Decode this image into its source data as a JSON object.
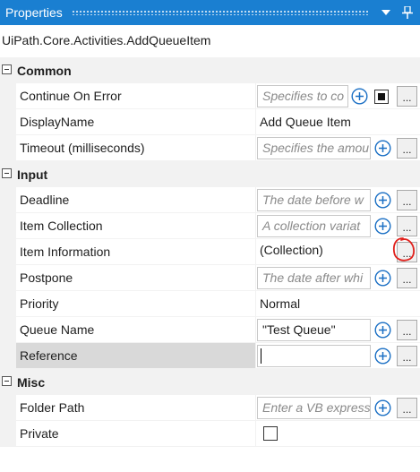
{
  "panel": {
    "title": "Properties"
  },
  "type_name": "UiPath.Core.Activities.AddQueueItem",
  "categories": [
    {
      "label": "Common",
      "properties": [
        {
          "name": "Continue On Error",
          "value": "Specifies to co",
          "placeholder": true
        },
        {
          "name": "DisplayName",
          "value": "Add Queue Item",
          "placeholder": false
        },
        {
          "name": "Timeout (milliseconds)",
          "value": "Specifies the amou",
          "placeholder": true
        }
      ]
    },
    {
      "label": "Input",
      "properties": [
        {
          "name": "Deadline",
          "value": "The date before w",
          "placeholder": true
        },
        {
          "name": "Item Collection",
          "value": "A collection variat",
          "placeholder": true
        },
        {
          "name": "Item Information",
          "value": "(Collection)",
          "placeholder": false
        },
        {
          "name": "Postpone",
          "value": "The date after whi",
          "placeholder": true
        },
        {
          "name": "Priority",
          "value": "Normal",
          "placeholder": false
        },
        {
          "name": "Queue Name",
          "value": "\"Test Queue\"",
          "placeholder": false
        },
        {
          "name": "Reference",
          "value": "",
          "placeholder": false
        }
      ]
    },
    {
      "label": "Misc",
      "properties": [
        {
          "name": "Folder Path",
          "value": "Enter a VB express",
          "placeholder": true
        },
        {
          "name": "Private",
          "value": "",
          "placeholder": false
        }
      ]
    }
  ],
  "ellipsis_label": "...",
  "colors": {
    "titlebar": "#1a7fd1",
    "grid_gutter": "#f2f2f2",
    "selected_row": "#d9d9d9",
    "plus_icon": "#1a6fc4",
    "annotation": "#e0201b"
  },
  "icons": [
    "dropdown-arrow-icon",
    "pin-icon",
    "collapse-icon",
    "plus-circle-icon",
    "ellipsis-icon",
    "checkbox",
    "red-circle-annotation"
  ]
}
